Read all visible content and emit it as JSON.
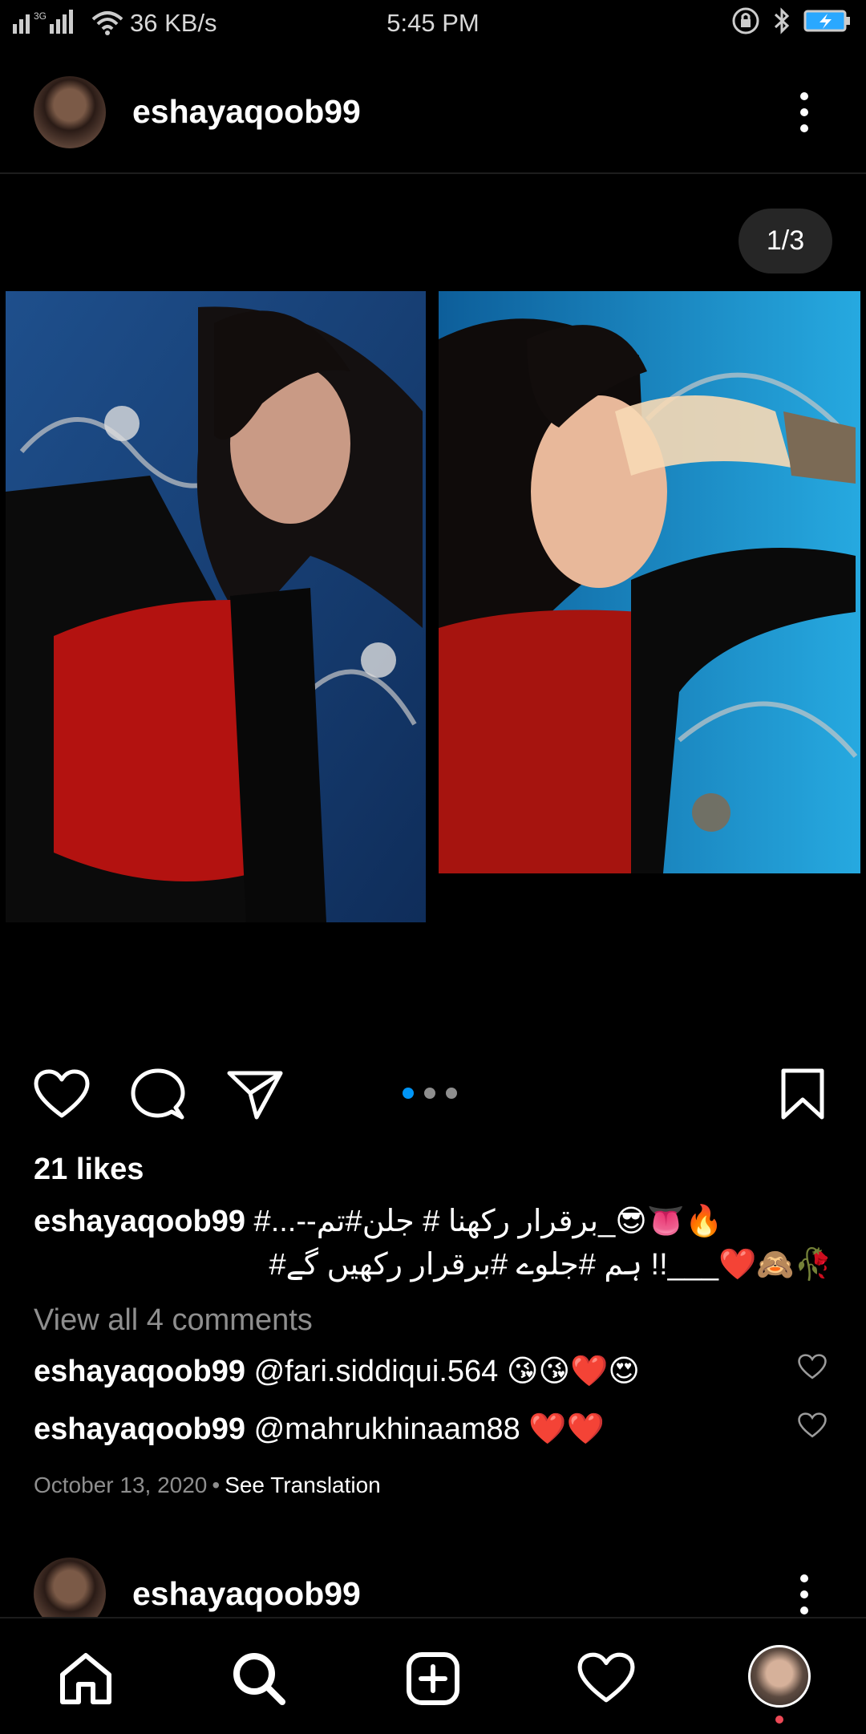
{
  "status_bar": {
    "signal_icon": "signal-bars-icon",
    "network_type": "3G",
    "speed": "36 KB/s",
    "time": "5:45 PM",
    "icons": [
      "wifi-icon",
      "lock-rotation-icon",
      "bluetooth-icon",
      "battery-charging-icon"
    ]
  },
  "post": {
    "username": "eshayaqoob99",
    "counter": "1/3",
    "carousel_index": 0,
    "carousel_total": 3,
    "likes": "21 likes",
    "caption_user": "eshayaqoob99",
    "caption_line1": " #...--برقرار رکھنا # جلن#تم_😎👅🔥",
    "caption_line2": "#ہم #جلوے #برقرار رکھیں گے !!___❤️🙈🥀",
    "view_all_comments": "View all 4 comments",
    "comments": [
      {
        "user": "eshayaqoob99",
        "text": "@fari.siddiqui.564 😘😘❤️😍"
      },
      {
        "user": "eshayaqoob99",
        "text": "@mahrukhinaam88 ❤️❤️"
      }
    ],
    "date": "October 13, 2020",
    "separator": "•",
    "see_translation": "See Translation"
  },
  "next_post": {
    "username": "eshayaqoob99"
  },
  "nav": [
    "home-icon",
    "search-icon",
    "add-post-icon",
    "activity-heart-icon",
    "profile-avatar"
  ],
  "colors": {
    "background": "#000000",
    "accent": "#0095f6",
    "muted": "#8e8e8e",
    "notification": "#ed4956"
  }
}
